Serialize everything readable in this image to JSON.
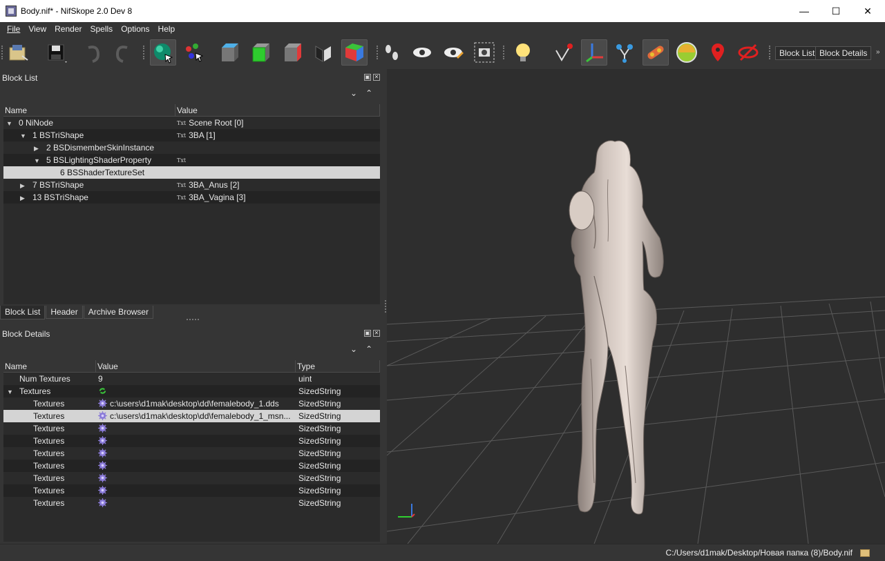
{
  "window": {
    "title": "Body.nif* - NifSkope 2.0 Dev 8"
  },
  "menu": [
    "File",
    "View",
    "Render",
    "Spells",
    "Options",
    "Help"
  ],
  "toolbar": {
    "icons": [
      "open-icon",
      "save-icon",
      "undo-icon",
      "redo-icon",
      "select-object-icon",
      "select-vertex-icon",
      "view-top-icon",
      "view-front-icon",
      "view-side-icon",
      "view-walk-icon",
      "view-user-icon",
      "textures-icon",
      "show-hidden-icon",
      "show-nodes-icon",
      "screenshot-icon",
      "lighting-icon",
      "vertex-colors-icon",
      "show-axes-icon",
      "show-constraints-icon",
      "show-markers-icon",
      "show-havok-icon",
      "show-furniture-icon",
      "show-markers-pin-icon",
      "hide-icon"
    ],
    "block_list_btn": "Block List",
    "block_details_btn": "Block Details"
  },
  "block_list": {
    "title": "Block List",
    "columns": [
      "Name",
      "Value"
    ],
    "rows": [
      {
        "arrow": "▼",
        "name": "0 NiNode",
        "txt": "Txt",
        "value": "Scene Root [0]"
      },
      {
        "arrow": "▼",
        "name": "1 BSTriShape",
        "txt": "Txt",
        "value": "3BA [1]"
      },
      {
        "arrow": "▶",
        "name": "2 BSDismemberSkinInstance",
        "txt": "",
        "value": ""
      },
      {
        "arrow": "▼",
        "name": "5 BSLightingShaderProperty",
        "txt": "Txt",
        "value": ""
      },
      {
        "arrow": "",
        "name": "6 BSShaderTextureSet",
        "txt": "",
        "value": ""
      },
      {
        "arrow": "▶",
        "name": "7 BSTriShape",
        "txt": "Txt",
        "value": "3BA_Anus [2]"
      },
      {
        "arrow": "▶",
        "name": "13 BSTriShape",
        "txt": "Txt",
        "value": "3BA_Vagina [3]"
      }
    ]
  },
  "tabs": [
    "Block List",
    "Header",
    "Archive Browser"
  ],
  "block_details": {
    "title": "Block Details",
    "columns": [
      "Name",
      "Value",
      "Type"
    ],
    "rows": [
      {
        "arrow": "",
        "name": "Num Textures",
        "value": "9",
        "type": "uint"
      },
      {
        "arrow": "▼",
        "name": "Textures",
        "value": "",
        "type": "SizedString"
      },
      {
        "arrow": "",
        "name": "Textures",
        "value": "c:\\users\\d1mak\\desktop\\dd\\femalebody_1.dds",
        "type": "SizedString"
      },
      {
        "arrow": "",
        "name": "Textures",
        "value": "c:\\users\\d1mak\\desktop\\dd\\femalebody_1_msn...",
        "type": "SizedString"
      },
      {
        "arrow": "",
        "name": "Textures",
        "value": "",
        "type": "SizedString"
      },
      {
        "arrow": "",
        "name": "Textures",
        "value": "",
        "type": "SizedString"
      },
      {
        "arrow": "",
        "name": "Textures",
        "value": "",
        "type": "SizedString"
      },
      {
        "arrow": "",
        "name": "Textures",
        "value": "",
        "type": "SizedString"
      },
      {
        "arrow": "",
        "name": "Textures",
        "value": "",
        "type": "SizedString"
      },
      {
        "arrow": "",
        "name": "Textures",
        "value": "",
        "type": "SizedString"
      },
      {
        "arrow": "",
        "name": "Textures",
        "value": "",
        "type": "SizedString"
      }
    ]
  },
  "status": {
    "path": "C:/Users/d1mak/Desktop/Новая папка (8)/Body.nif"
  }
}
